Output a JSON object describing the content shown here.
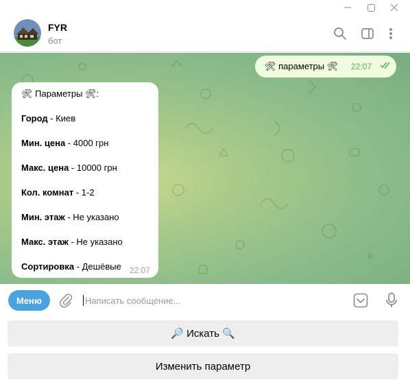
{
  "header": {
    "title": "FYR",
    "subtitle": "бот",
    "icons": [
      "search-icon",
      "sidebar-toggle-icon",
      "more-vertical-icon"
    ]
  },
  "window_controls": [
    "minimize-icon",
    "maximize-icon",
    "close-icon"
  ],
  "messages": {
    "outgoing": {
      "text": "🛠 параметры 🛠",
      "time": "22:07",
      "status": "read"
    },
    "incoming": {
      "title": "🛠 Параметры 🛠:",
      "fields": [
        {
          "label": "Город",
          "value": " - Киев"
        },
        {
          "label": "Мин. цена",
          "value": " - 4000 грн"
        },
        {
          "label": "Макс. цена",
          "value": " - 10000 грн"
        },
        {
          "label": "Кол. комнат",
          "value": " - 1-2"
        },
        {
          "label": "Мин. этаж",
          "value": " - Не указано"
        },
        {
          "label": "Макс. этаж",
          "value": " - Не указано"
        },
        {
          "label": "Сортировка",
          "value": " - Дешёвые"
        }
      ],
      "time": "22:07"
    }
  },
  "composer": {
    "menu_label": "Меню",
    "placeholder": "Написать сообщение...",
    "value": ""
  },
  "keyboard": {
    "search_label": "🔎 Искать 🔍",
    "change_label": "Изменить параметр"
  },
  "colors": {
    "accent": "#4aa3df",
    "outgoing_bubble": "#effdde",
    "read_check": "#5da85a"
  }
}
